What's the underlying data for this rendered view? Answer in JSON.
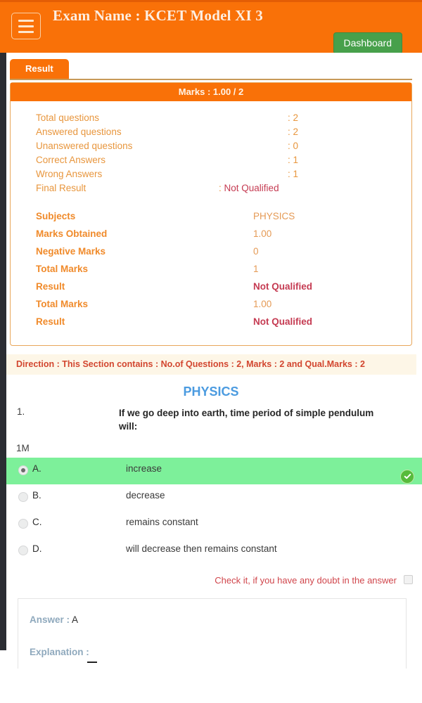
{
  "header": {
    "menu_icon": "hamburger-icon",
    "title": "Exam Name : KCET Model XI 3",
    "dashboard_label": "Dashboard",
    "accent_color": "#f97108",
    "dashboard_color": "#47a04b"
  },
  "tabs": [
    {
      "label": "Result",
      "active": true
    }
  ],
  "result_card": {
    "marks_header": "Marks : 1.00 / 2",
    "summary_rows": [
      {
        "label": "Total questions",
        "colon": ":",
        "value": "2"
      },
      {
        "label": "Answered questions",
        "colon": ":",
        "value": "2"
      },
      {
        "label": "Unanswered questions",
        "colon": ":",
        "value": "0"
      },
      {
        "label": "Correct Answers",
        "colon": ":",
        "value": "1"
      },
      {
        "label": "Wrong Answers",
        "colon": ":",
        "value": "1"
      },
      {
        "label": "Final Result",
        "colon": ":",
        "value": "Not Qualified"
      }
    ],
    "detail_rows": [
      {
        "label": "Subjects",
        "value": "PHYSICS",
        "red": false
      },
      {
        "label": "Marks Obtained",
        "value": "1.00",
        "red": false
      },
      {
        "label": "Negative Marks",
        "value": "0",
        "red": false
      },
      {
        "label": "Total Marks",
        "value": "1",
        "red": false
      },
      {
        "label": "Result",
        "value": "Not Qualified",
        "red": true
      },
      {
        "label": "Total Marks",
        "value": "1.00",
        "red": false
      },
      {
        "label": "Result",
        "value": "Not Qualified",
        "red": true
      }
    ]
  },
  "direction": "Direction : This Section contains : No.of Questions : 2, Marks : 2 and Qual.Marks : 2",
  "section": {
    "subject_title": "PHYSICS",
    "subject_title_color": "#4b9be0"
  },
  "question": {
    "number": "1.",
    "text": "If we go deep into earth, time period of simple pendulum will:",
    "marks": "1M",
    "options": [
      {
        "letter": "A.",
        "text": "increase",
        "selected": true,
        "correct": true
      },
      {
        "letter": "B.",
        "text": "decrease",
        "selected": false,
        "correct": false
      },
      {
        "letter": "C.",
        "text": "remains constant",
        "selected": false,
        "correct": false
      },
      {
        "letter": "D.",
        "text": "will decrease then remains constant",
        "selected": false,
        "correct": false
      }
    ],
    "correct_highlight_color": "#7df09a",
    "correct_badge_icon": "check-circle-icon",
    "doubt_label": "Check it, if you have any doubt in the answer",
    "doubt_checked": false,
    "answer_key_label": "Answer :",
    "answer_value": "A",
    "explanation_label": "Explanation :"
  }
}
